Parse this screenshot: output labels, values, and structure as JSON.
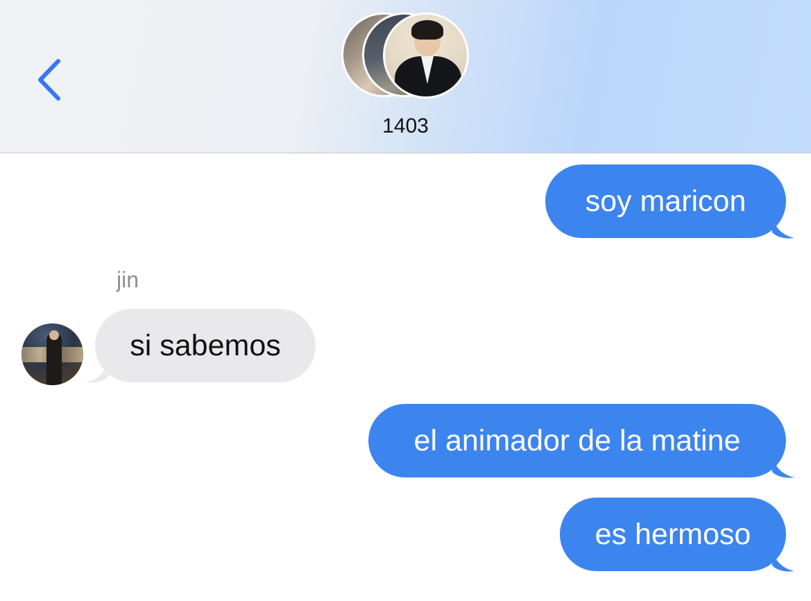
{
  "header": {
    "title": "1403",
    "back_icon": "chevron-left-icon",
    "accent_color": "#3478f6"
  },
  "messages": [
    {
      "direction": "outgoing",
      "text": "soy maricon"
    },
    {
      "direction": "incoming",
      "sender": "jin",
      "text": "si sabemos"
    },
    {
      "direction": "outgoing",
      "text": "el animador de la matine"
    },
    {
      "direction": "outgoing",
      "text": "es hermoso"
    }
  ],
  "colors": {
    "outgoing_bubble": "#3d85ee",
    "incoming_bubble": "#e9e9eb",
    "sender_name": "#8e8e93"
  }
}
